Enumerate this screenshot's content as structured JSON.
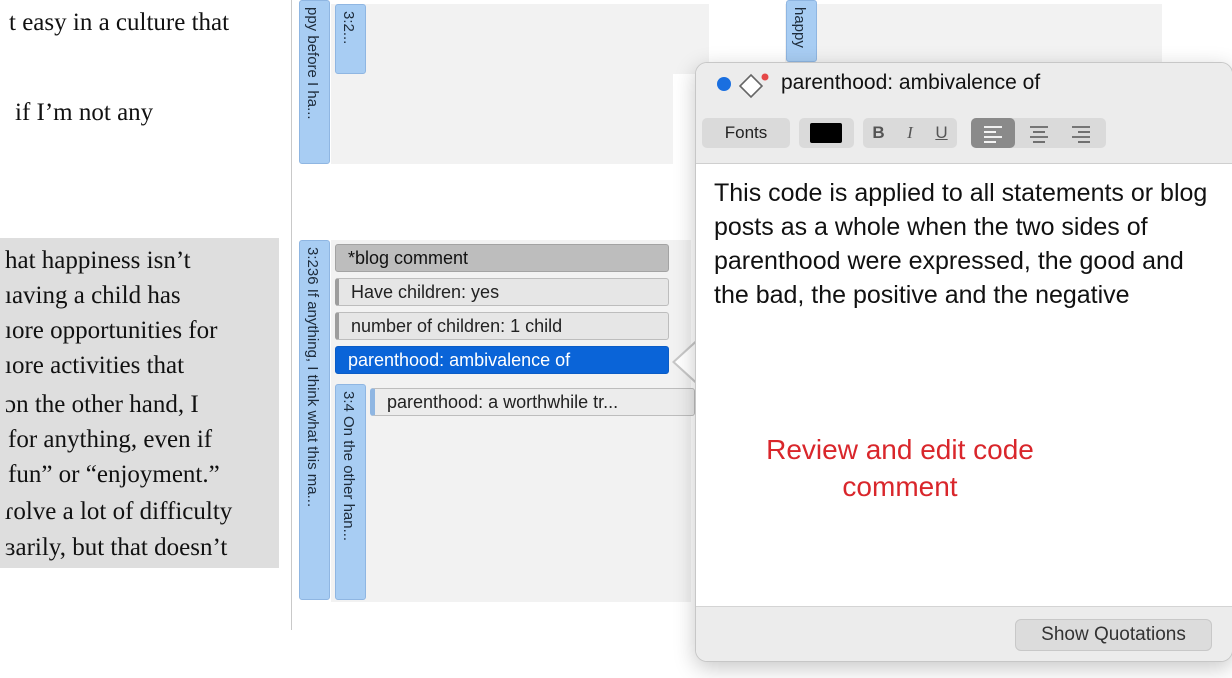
{
  "document": {
    "lines_top": [
      "t easy in a culture that",
      "if I’m not any"
    ],
    "lines_highlight": [
      "hat happiness isn’t",
      "ıaving a child has",
      "ıore opportunities for",
      "ıore activities that",
      "ɔn the other hand, I",
      "for anything, even if",
      "fun” or “enjoyment.”",
      "ɾolve a lot of difficulty",
      "ɜarily, but that doesn’t"
    ]
  },
  "quotation_tabs": {
    "q1": "ppy before I ha...",
    "q2": "3:2...",
    "q3": "happy",
    "q4": "3:236 If anything, I think what this ma...",
    "q5": "3:4 On the other han..."
  },
  "codes": [
    {
      "label": "*blog comment",
      "style": "dark"
    },
    {
      "label": "Have children: yes",
      "style": "grey"
    },
    {
      "label": "number of children: 1 child",
      "style": "grey"
    },
    {
      "label": "parenthood: ambivalence of",
      "style": "selected"
    },
    {
      "label": "parenthood: a worthwhile tr...",
      "style": "blue"
    }
  ],
  "popover": {
    "title": "parenthood: ambivalence of",
    "toolbar": {
      "fonts_label": "Fonts",
      "bold_label": "B",
      "italic_label": "I",
      "underline_label": "U",
      "text_color": "#000000"
    },
    "comment": "This code is applied to all statements or blog posts as a whole when the two sides of parenthood were expressed, the good and the bad, the positive and the negative",
    "annotation": "Review and edit code comment",
    "show_quotations_label": "Show Quotations",
    "code_color": "#1a6fe0"
  },
  "colors": {
    "accent_blue": "#0a64d8",
    "quote_tab_blue": "#a8cdf3",
    "annotation_red": "#d9262b"
  }
}
